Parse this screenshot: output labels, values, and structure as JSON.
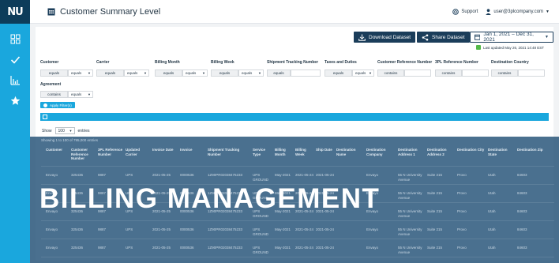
{
  "app": {
    "logo_text": "NU",
    "title": "Customer Summary Level"
  },
  "topbar": {
    "support_label": "Support",
    "user_label": "user@3plcompany.com"
  },
  "sidebar": {
    "icons": [
      "dashboard-icon",
      "check-icon",
      "chart-icon",
      "star-icon"
    ]
  },
  "toolbar": {
    "download_label": "Download Dataset",
    "share_label": "Share Dataset",
    "date_range": "Jan 1, 2021 – Dec 31, 2021",
    "updated_text": "Last updated May 26, 2021 14:48 EST"
  },
  "filters": {
    "row1": [
      {
        "label": "Customer",
        "op": "equals"
      },
      {
        "label": "Carrier",
        "op": "equals"
      },
      {
        "label": "Billing Month",
        "op": "equals"
      },
      {
        "label": "Billing Week",
        "op": "equals"
      },
      {
        "label": "Shipment Tracking Number",
        "op": "equals"
      },
      {
        "label": "Taxes and Duties",
        "op": "equals"
      },
      {
        "label": "Customer Reference Number",
        "op": "contains"
      },
      {
        "label": "3PL Reference Number",
        "op": "contains"
      },
      {
        "label": "Destination Country",
        "op": "contains"
      }
    ],
    "agreement": {
      "label": "Agreement",
      "op": "contains"
    },
    "apply_label": "Apply Filter(s)"
  },
  "table_controls": {
    "show_label": "Show",
    "page_size": "100",
    "entries_label": "entries",
    "showing_text": "Showing 1 to 100 of 795,000 entries"
  },
  "table": {
    "columns": [
      "Customer",
      "Customer Reference Number",
      "3PL Reference Number",
      "Updated Carrier",
      "Invoice Date",
      "Invoice",
      "Shipment Tracking Number",
      "Service Type",
      "Billing Month",
      "Billing Week",
      "Ship Date",
      "Destination Name",
      "Destination Company",
      "Destination Address 1",
      "Destination Address 2",
      "Destination City",
      "Destination State",
      "Destination Zip"
    ],
    "rows": [
      [
        "Envayo",
        "325436",
        "9887",
        "UPS",
        "2021-05-25",
        "0000536",
        "1Z90PR02038475233",
        "UPS GROUND",
        "May-2021",
        "2021-05-24",
        "2021-05-24",
        "",
        "Envayo",
        "55 N University Avenue",
        "Suite 215",
        "Provo",
        "Utah",
        "84603"
      ],
      [
        "Envayo",
        "325436",
        "9887",
        "UPS",
        "2021-05-25",
        "0000536",
        "1Z90PR02038475233",
        "UPS GROUND",
        "May-2021",
        "2021-05-24",
        "2021-05-24",
        "",
        "Envayo",
        "55 N University Avenue",
        "Suite 215",
        "Provo",
        "Utah",
        "84603"
      ],
      [
        "Envayo",
        "325436",
        "9887",
        "UPS",
        "2021-05-25",
        "0000536",
        "1Z90PR02038475233",
        "UPS GROUND",
        "May-2021",
        "2021-05-24",
        "2021-05-24",
        "",
        "Envayo",
        "55 N University Avenue",
        "Suite 215",
        "Provo",
        "Utah",
        "84603"
      ],
      [
        "Envayo",
        "325436",
        "9887",
        "UPS",
        "2021-05-25",
        "0000536",
        "1Z90PR02038475233",
        "UPS GROUND",
        "May-2021",
        "2021-05-24",
        "2021-05-24",
        "",
        "Envayo",
        "55 N University Avenue",
        "Suite 215",
        "Provo",
        "Utah",
        "84603"
      ],
      [
        "Envayo",
        "325436",
        "9887",
        "UPS",
        "2021-05-25",
        "0000536",
        "1Z90PR02038475233",
        "UPS GROUND",
        "May-2021",
        "2021-05-24",
        "2021-05-24",
        "",
        "Envayo",
        "55 N University Avenue",
        "Suite 215",
        "Provo",
        "Utah",
        "84603"
      ],
      [
        "Envayo",
        "325436",
        "9887",
        "UPS",
        "2021-05-25",
        "0000536",
        "1Z90PR02038475233",
        "UPS GROUND",
        "May-2021",
        "2021-05-24",
        "2021-05-24",
        "",
        "Envayo",
        "55 N University Avenue",
        "Suite 215",
        "Provo",
        "Utah",
        "84603"
      ]
    ]
  },
  "banner": {
    "text": "BILLING MANAGEMENT"
  },
  "colors": {
    "sidebar": "#1aa7dd",
    "navy": "#1b3d5a",
    "accent_blue": "#1aa7dd",
    "check_green": "#54b948"
  }
}
